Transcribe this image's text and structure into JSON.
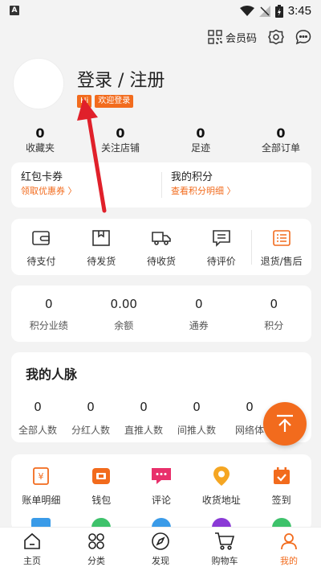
{
  "status_bar": {
    "time": "3:45",
    "app_badge": "A"
  },
  "top_bar": {
    "member_code_label": "会员码"
  },
  "profile": {
    "login_title": "登录 / 注册",
    "tag_hi": "Hi",
    "tag_welcome": "欢迎登录"
  },
  "counters": [
    {
      "value": "0",
      "label": "收藏夹"
    },
    {
      "value": "0",
      "label": "关注店铺"
    },
    {
      "value": "0",
      "label": "足迹"
    },
    {
      "value": "0",
      "label": "全部订单"
    }
  ],
  "coupons": {
    "left_title": "红包卡券",
    "left_link": "领取优惠券 〉",
    "right_title": "我的积分",
    "right_link": "查看积分明细 〉"
  },
  "orders": [
    {
      "label": "待支付",
      "icon": "wallet-icon"
    },
    {
      "label": "待发货",
      "icon": "box-icon"
    },
    {
      "label": "待收货",
      "icon": "truck-icon"
    },
    {
      "label": "待评价",
      "icon": "comment-icon"
    },
    {
      "label": "退货/售后",
      "icon": "return-list-icon"
    }
  ],
  "wallet": [
    {
      "value": "0",
      "label": "积分业绩"
    },
    {
      "value": "0.00",
      "label": "余额"
    },
    {
      "value": "0",
      "label": "通券"
    },
    {
      "value": "0",
      "label": "积分"
    }
  ],
  "network": {
    "title": "我的人脉",
    "items": [
      {
        "value": "0",
        "label": "全部人数"
      },
      {
        "value": "0",
        "label": "分红人数"
      },
      {
        "value": "0",
        "label": "直推人数"
      },
      {
        "value": "0",
        "label": "间推人数"
      },
      {
        "value": "0",
        "label": "网络体"
      }
    ]
  },
  "tools": [
    {
      "label": "账单明细",
      "icon": "bill-icon"
    },
    {
      "label": "钱包",
      "icon": "purse-icon"
    },
    {
      "label": "评论",
      "icon": "chat-icon"
    },
    {
      "label": "收货地址",
      "icon": "location-icon"
    },
    {
      "label": "签到",
      "icon": "calendar-check-icon"
    }
  ],
  "tabs": [
    {
      "label": "主页",
      "icon": "home-icon"
    },
    {
      "label": "分类",
      "icon": "category-icon"
    },
    {
      "label": "发现",
      "icon": "compass-icon"
    },
    {
      "label": "购物车",
      "icon": "cart-icon"
    },
    {
      "label": "我的",
      "icon": "profile-icon"
    }
  ],
  "colors": {
    "accent": "#f26b1d",
    "annotation_red": "#e0202a",
    "background": "#f3f3f3"
  }
}
